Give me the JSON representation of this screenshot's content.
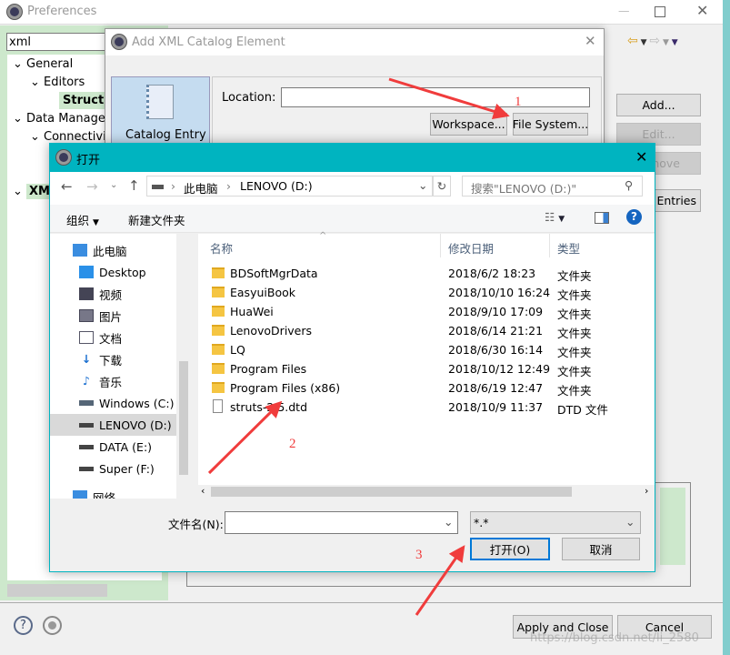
{
  "preferences": {
    "title": "Preferences",
    "filter_value": "xml",
    "tree": [
      {
        "label": "General",
        "bold": false
      },
      {
        "label": "Editors",
        "bold": false
      },
      {
        "label": "Structur",
        "bold": true
      },
      {
        "label": "Data Manager",
        "bold": false
      },
      {
        "label": "Connectivit",
        "bold": false
      },
      {
        "label": "XML",
        "bold": true
      }
    ],
    "buttons": {
      "add": "Add...",
      "edit": "Edit...",
      "remove": "move",
      "entries": "l Entries"
    },
    "apply_close": "Apply and Close",
    "cancel": "Cancel"
  },
  "catalog_dialog": {
    "title": "Add XML Catalog Element",
    "entry_label": "Catalog Entry",
    "location_label": "Location:",
    "location_value": "",
    "workspace": "Workspace...",
    "file_system": "File System..."
  },
  "open_dialog": {
    "title": "打开",
    "breadcrumb": [
      "此电脑",
      "LENOVO (D:)"
    ],
    "search_placeholder": "搜索\"LENOVO (D:)\"",
    "organize": "组织",
    "new_folder": "新建文件夹",
    "nav": [
      "此电脑",
      "Desktop",
      "视频",
      "图片",
      "文档",
      "下载",
      "音乐",
      "Windows (C:)",
      "LENOVO (D:)",
      "DATA (E:)",
      "Super (F:)",
      "网络"
    ],
    "columns": [
      "名称",
      "修改日期",
      "类型"
    ],
    "files": [
      {
        "name": "BDSoftMgrData",
        "date": "2018/6/2 18:23",
        "type": "文件夹",
        "kind": "folder"
      },
      {
        "name": "EasyuiBook",
        "date": "2018/10/10 16:24",
        "type": "文件夹",
        "kind": "folder"
      },
      {
        "name": "HuaWei",
        "date": "2018/9/10 17:09",
        "type": "文件夹",
        "kind": "folder"
      },
      {
        "name": "LenovoDrivers",
        "date": "2018/6/14 21:21",
        "type": "文件夹",
        "kind": "folder"
      },
      {
        "name": "LQ",
        "date": "2018/6/30 16:14",
        "type": "文件夹",
        "kind": "folder"
      },
      {
        "name": "Program Files",
        "date": "2018/10/12 12:49",
        "type": "文件夹",
        "kind": "folder"
      },
      {
        "name": "Program Files (x86)",
        "date": "2018/6/19 12:47",
        "type": "文件夹",
        "kind": "folder"
      },
      {
        "name": "struts-2.5.dtd",
        "date": "2018/10/9 11:37",
        "type": "DTD 文件",
        "kind": "file"
      }
    ],
    "filename_label": "文件名(N):",
    "filename_value": "",
    "filter": "*.*",
    "open": "打开(O)",
    "cancel": "取消"
  },
  "annotations": [
    "1",
    "2",
    "3"
  ],
  "watermark": "https://blog.csdn.net/li_2580",
  "colors": {
    "accent": "#00b4c0",
    "arrow": "#f03c3c",
    "highlight": "#cde8cc"
  }
}
